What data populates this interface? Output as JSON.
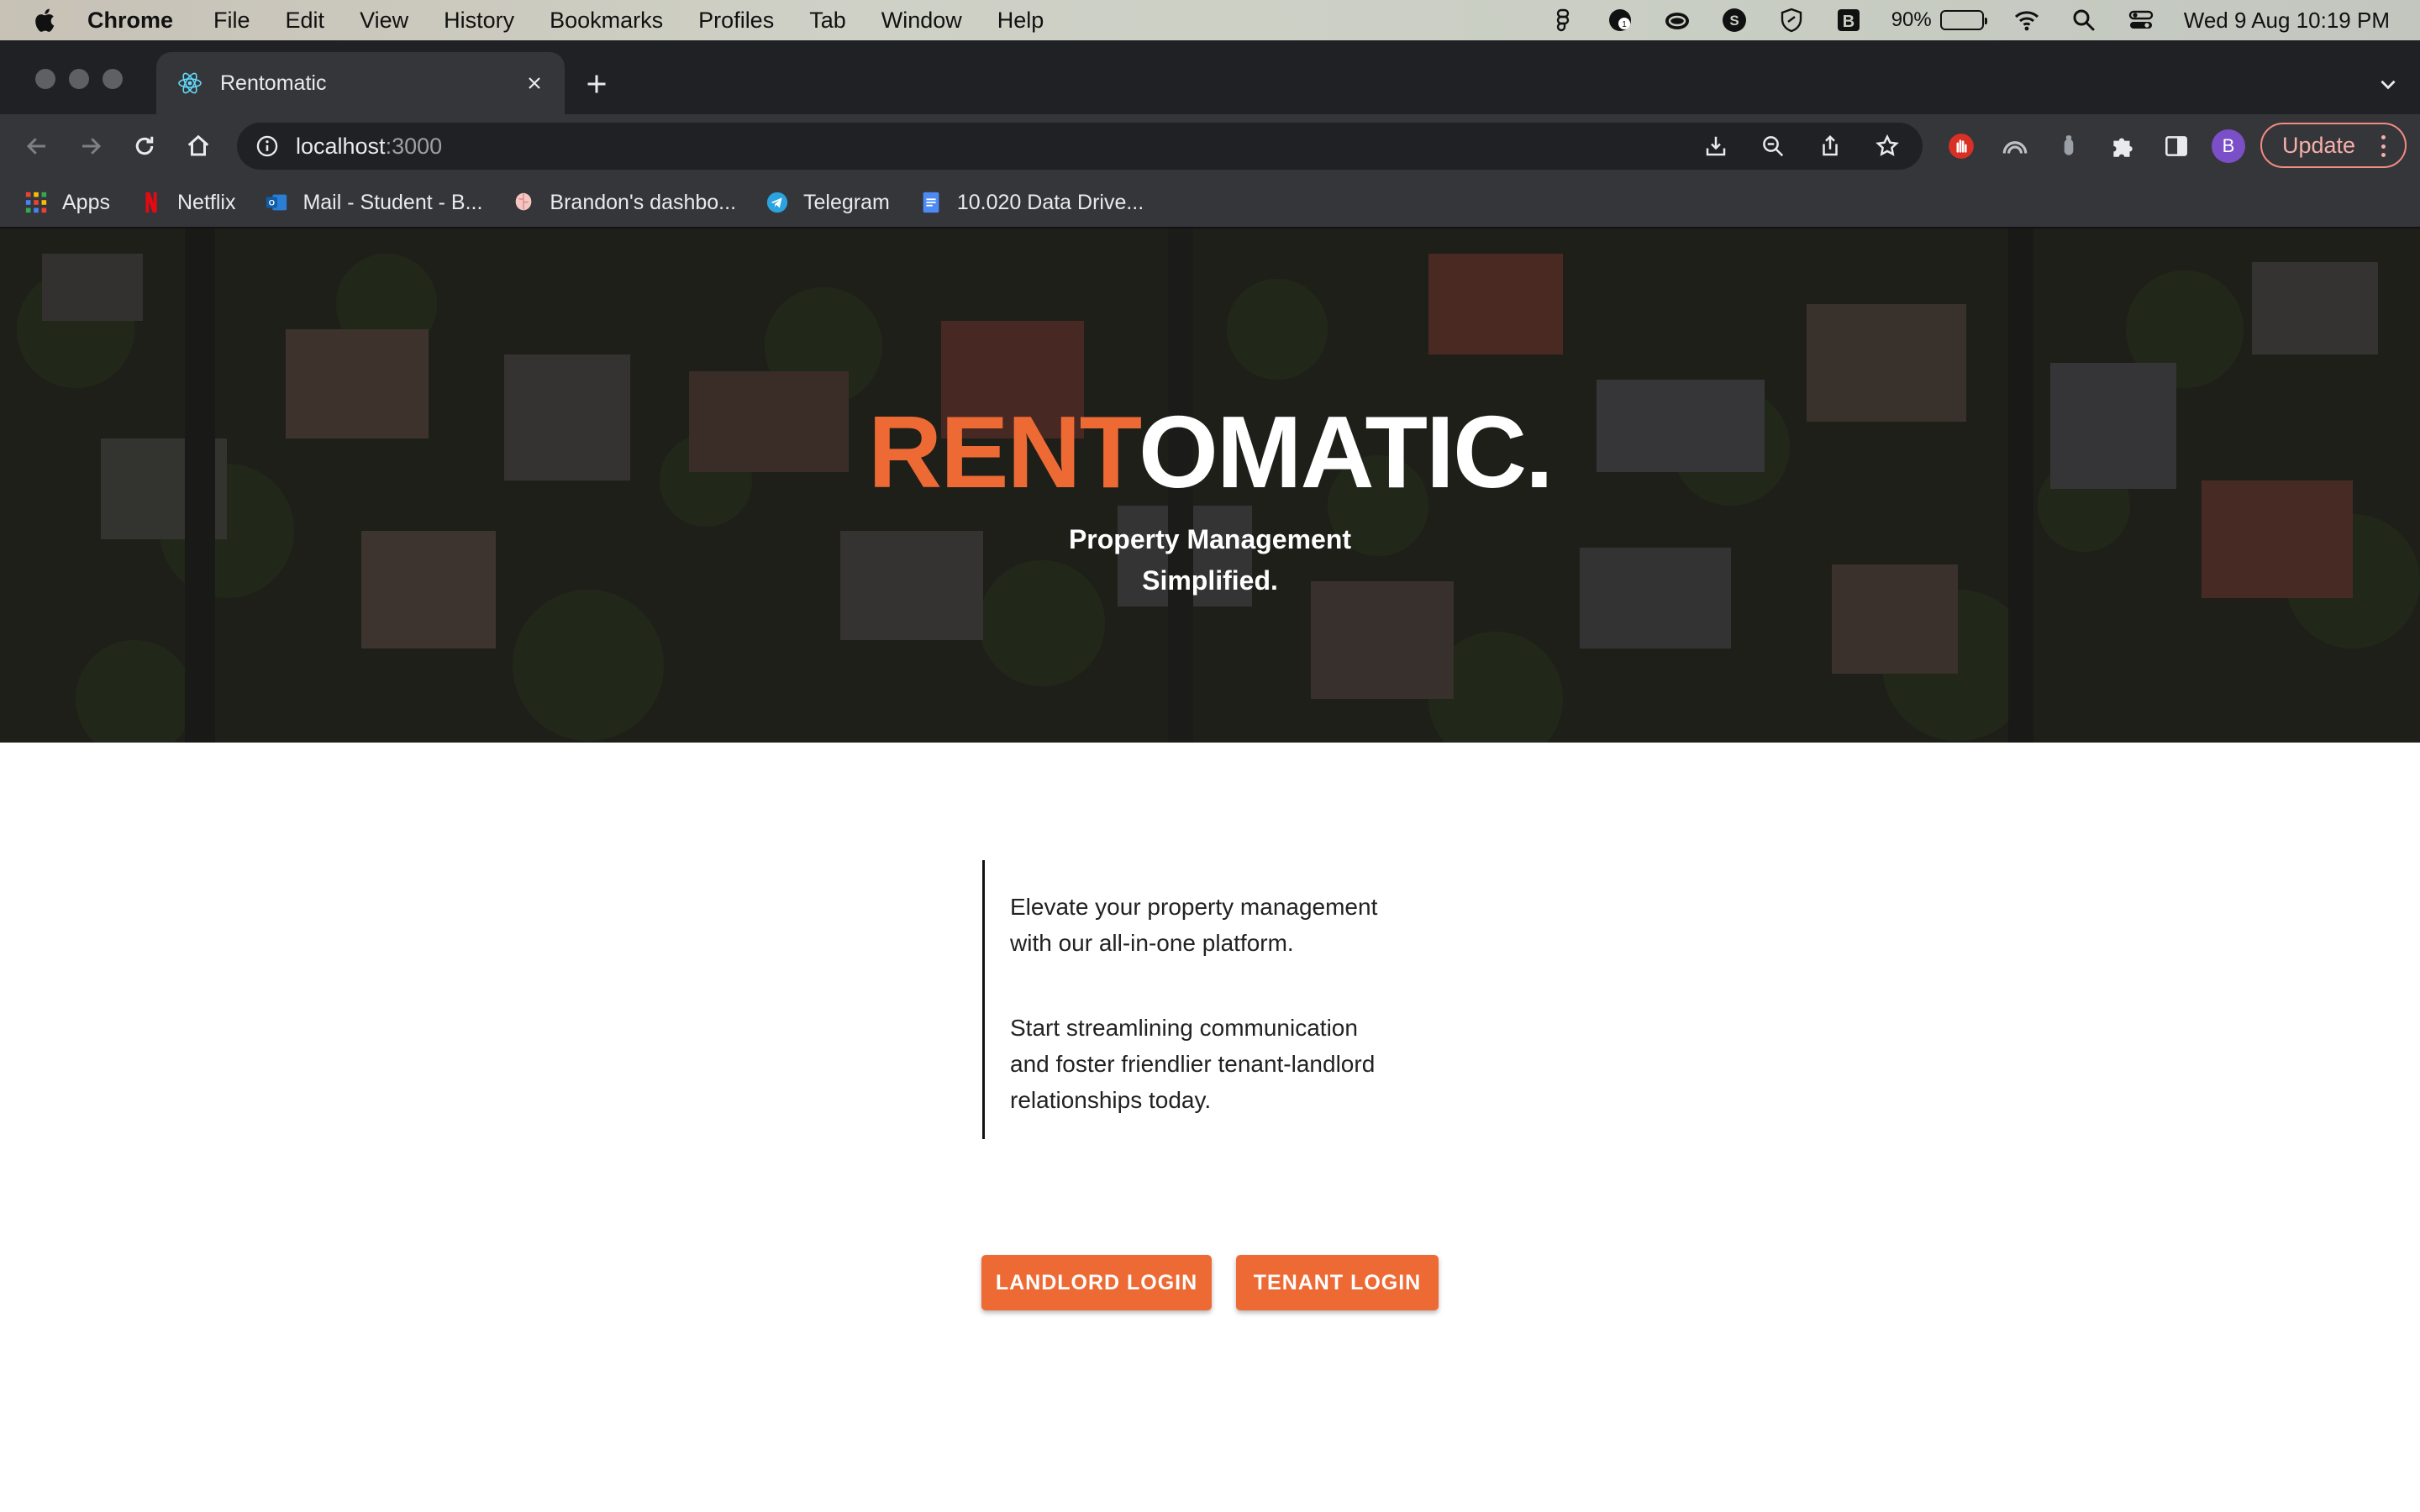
{
  "menubar": {
    "app_name": "Chrome",
    "items": [
      "File",
      "Edit",
      "View",
      "History",
      "Bookmarks",
      "Profiles",
      "Tab",
      "Window",
      "Help"
    ],
    "battery_percent": "90%",
    "battery_level": 0.9,
    "clock": "Wed 9 Aug  10:19 PM"
  },
  "browser": {
    "tab_title": "Rentomatic",
    "url_host": "localhost",
    "url_port": ":3000",
    "profile_initial": "B",
    "update_label": "Update",
    "bookmarks": [
      {
        "label": "Apps",
        "icon": "apps-grid-icon"
      },
      {
        "label": "Netflix",
        "icon": "netflix-icon"
      },
      {
        "label": "Mail - Student - B...",
        "icon": "outlook-icon"
      },
      {
        "label": "Brandon's dashbo...",
        "icon": "brain-icon"
      },
      {
        "label": "Telegram",
        "icon": "telegram-icon"
      },
      {
        "label": "10.020 Data Drive...",
        "icon": "google-docs-icon"
      }
    ]
  },
  "hero": {
    "brand_accent": "RENT",
    "brand_rest": "OMATIC.",
    "tagline_line1": "Property Management",
    "tagline_line2": "Simplified."
  },
  "blurb": {
    "para1_line1": "Elevate your property management",
    "para1_line2": "with our all-in-one platform.",
    "para2_line1": "Start streamlining communication",
    "para2_line2": "and foster friendlier tenant-landlord",
    "para2_line3": "relationships today."
  },
  "actions": {
    "landlord_login": "LANDLORD LOGIN",
    "tenant_login": "TENANT LOGIN"
  },
  "colors": {
    "accent": "#ee6a34",
    "chrome_dark": "#202124",
    "chrome_toolbar": "#35363a"
  }
}
